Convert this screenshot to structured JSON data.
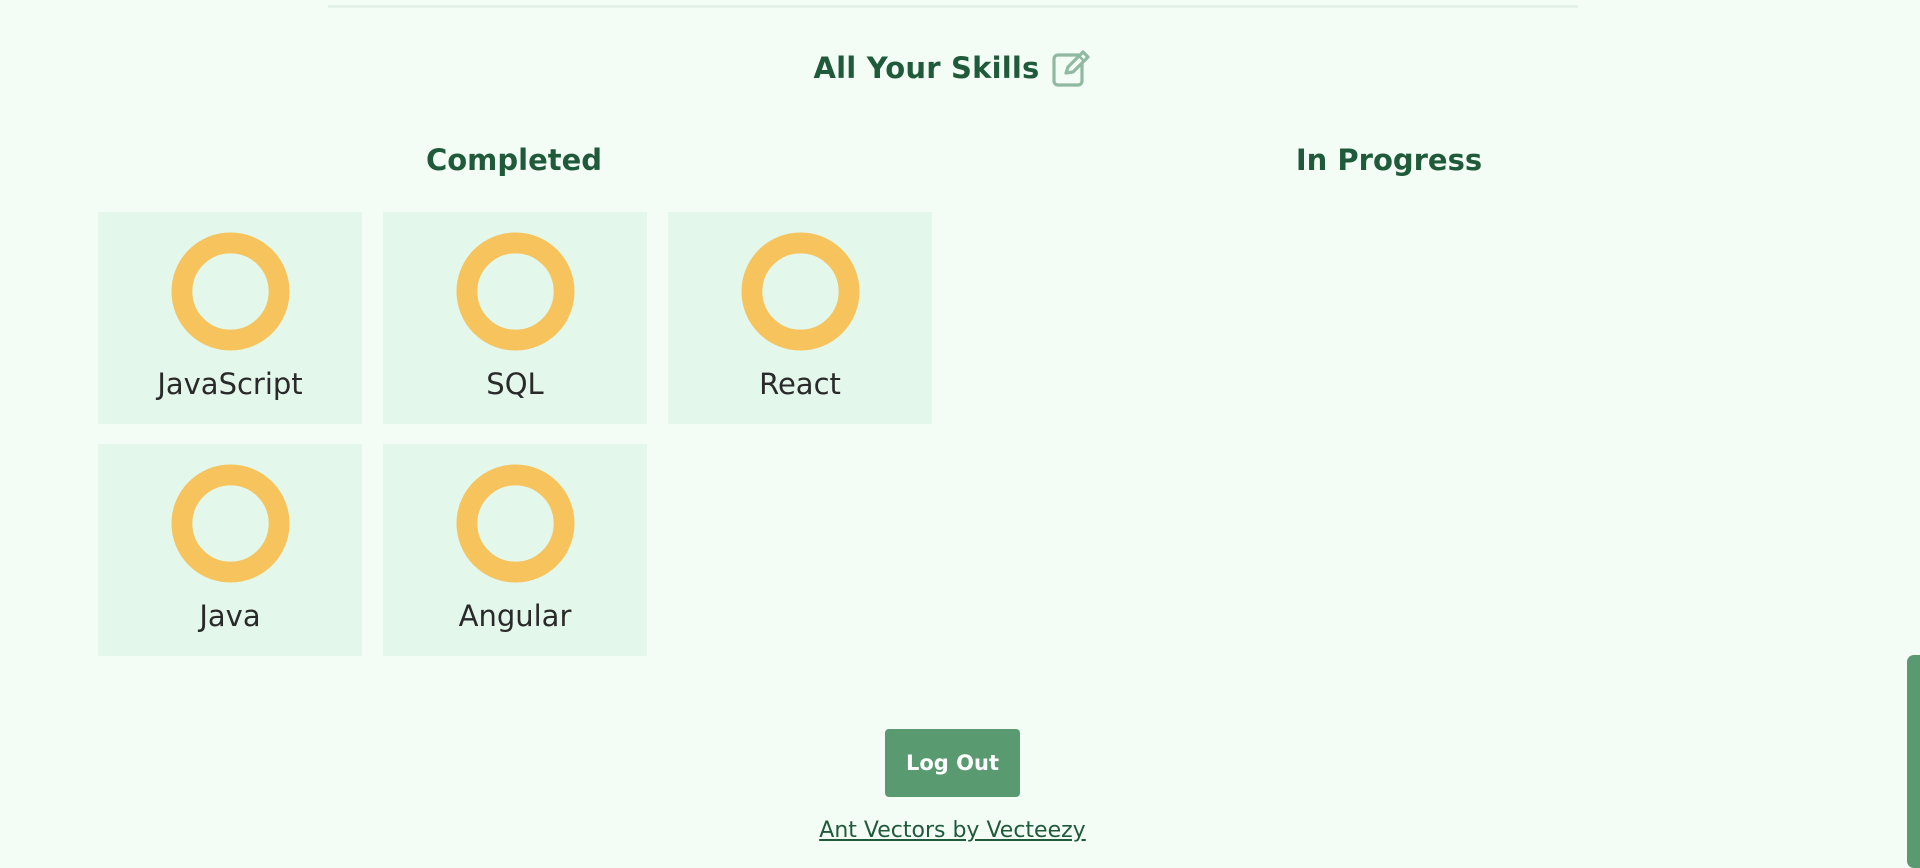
{
  "header": {
    "title": "All Your Skills",
    "edit_icon": "edit-icon"
  },
  "columns": {
    "completed_title": "Completed",
    "in_progress_title": "In Progress"
  },
  "completed_skills": [
    {
      "name": "JavaScript",
      "icon": "progress-ring-icon"
    },
    {
      "name": "SQL",
      "icon": "progress-ring-icon"
    },
    {
      "name": "React",
      "icon": "progress-ring-icon"
    },
    {
      "name": "Java",
      "icon": "progress-ring-icon"
    },
    {
      "name": "Angular",
      "icon": "progress-ring-icon"
    }
  ],
  "in_progress_skills": [],
  "footer": {
    "logout_label": "Log Out",
    "credit_text": "Ant Vectors by Vecteezy"
  },
  "colors": {
    "background": "#f4fdf5",
    "heading": "#1f5a3a",
    "card": "#e3f7ea",
    "ring": "#f6c35c",
    "button": "#5a9a70"
  }
}
